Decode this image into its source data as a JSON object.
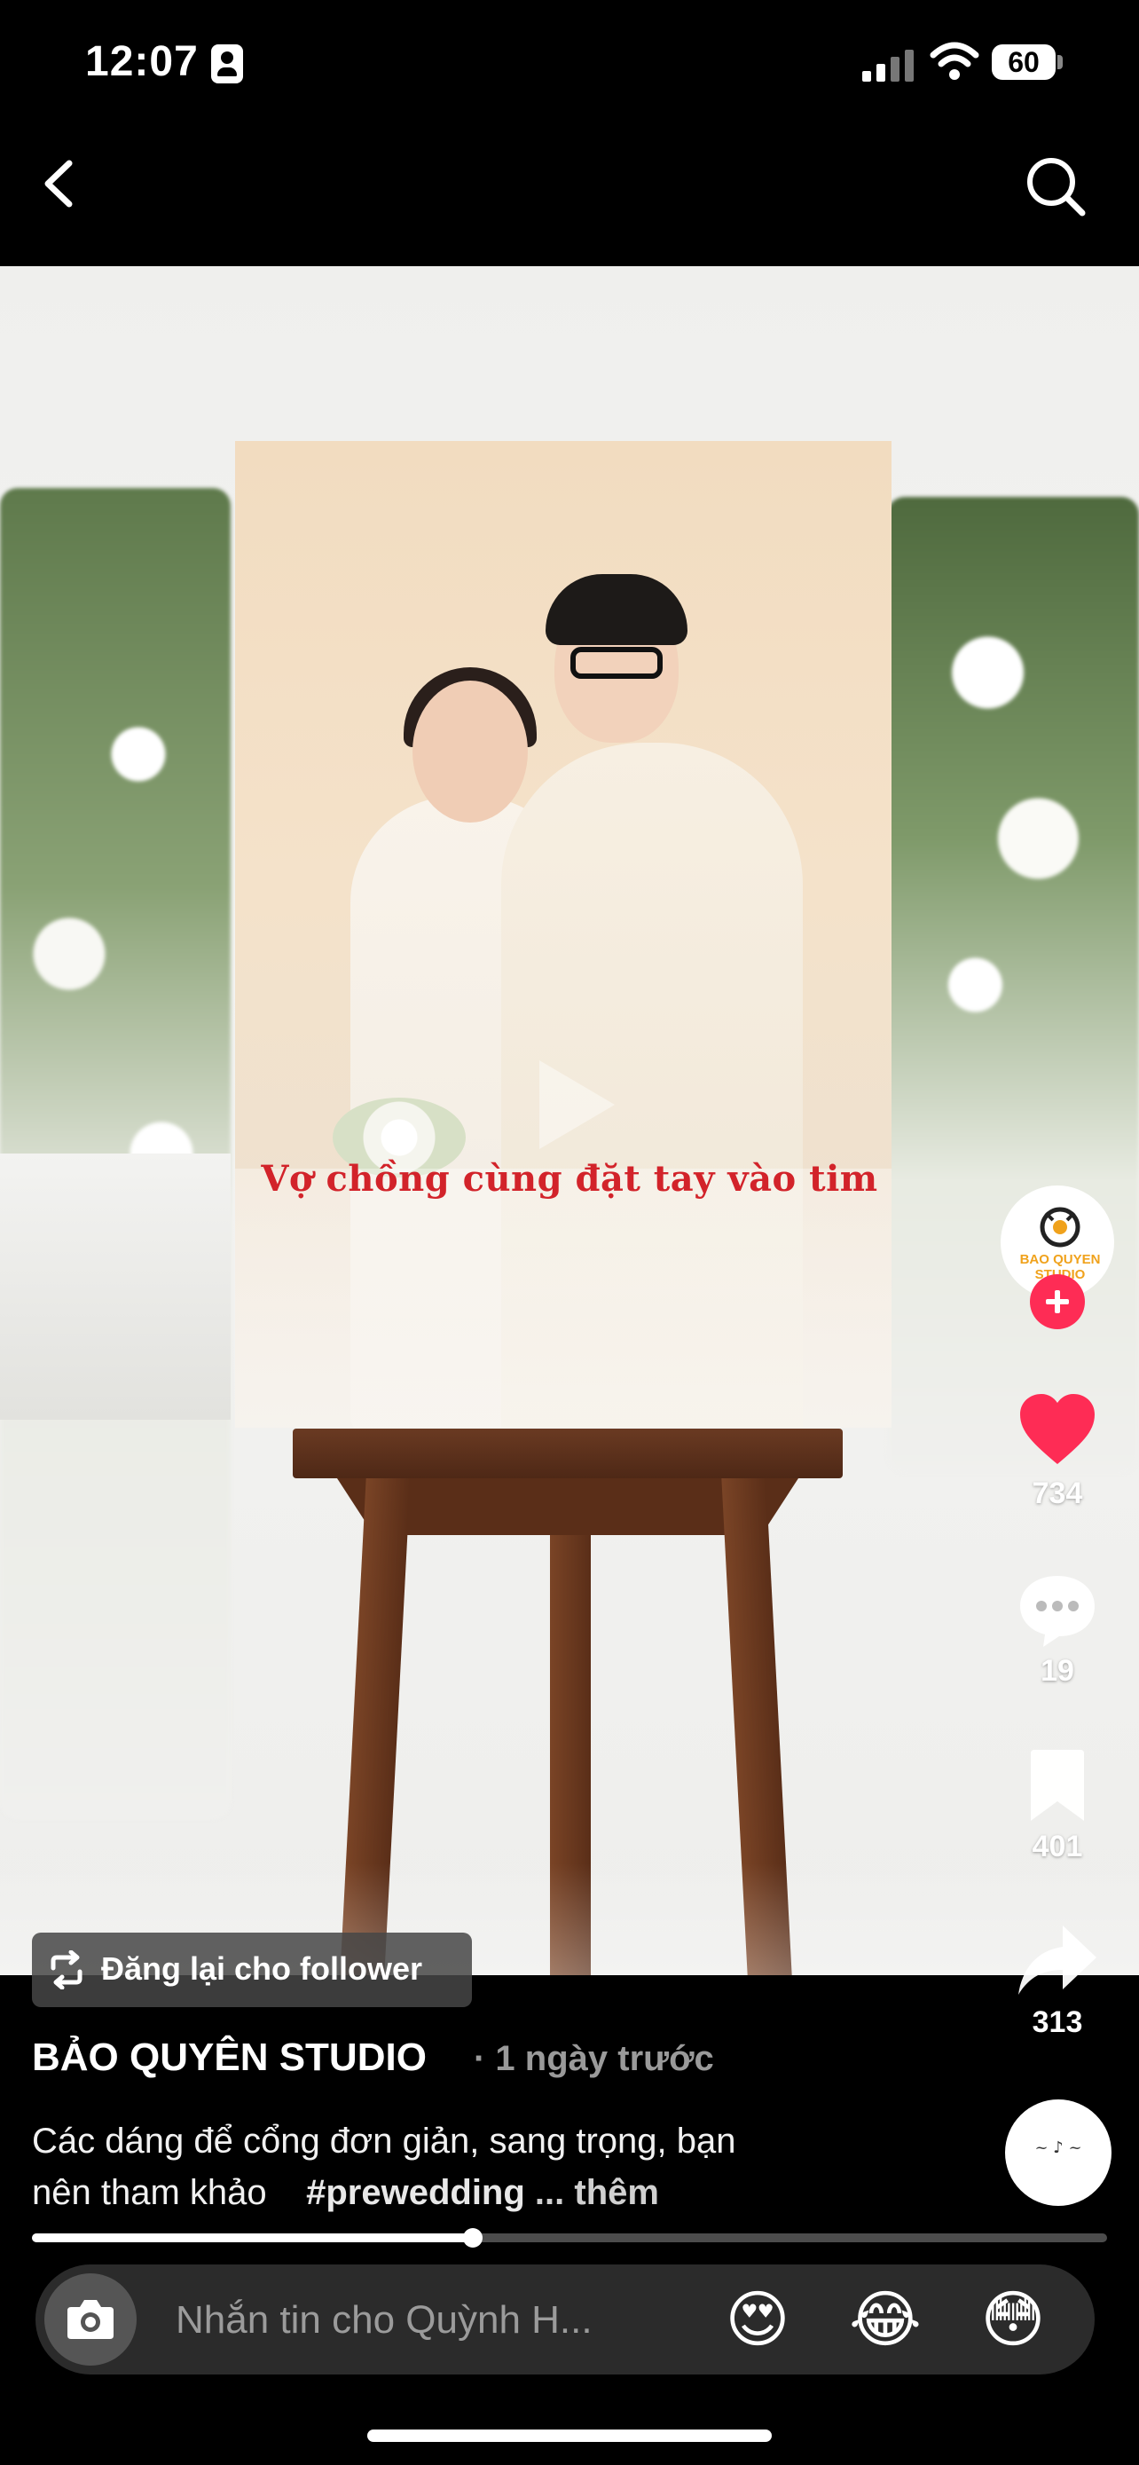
{
  "status_bar": {
    "time": "12:07",
    "battery": "60"
  },
  "video": {
    "caption": "Vợ  chồng cùng đặt tay  vào tim",
    "avatar_text": "BAO QUYEN STUDIO"
  },
  "actions": {
    "likes": "734",
    "comments": "19",
    "saves": "401",
    "shares": "313"
  },
  "repost": {
    "label": "Đăng lại cho follower"
  },
  "post": {
    "author": "BẢO QUYÊN STUDIO",
    "time": "· 1 ngày trước",
    "description_line1": "Các dáng để cổng đơn giản, sang trọng, bạn",
    "description_line2": "nên tham khảo",
    "hashtag": "#prewedding",
    "more": "... thêm"
  },
  "progress": {
    "fraction": 0.41
  },
  "message_bar": {
    "placeholder": "Nhắn tin cho Quỳnh H...",
    "emojis": [
      "😍",
      "😂",
      "😳"
    ]
  },
  "colors": {
    "like": "#fe2c55",
    "follow": "#fe2c55",
    "caption": "#d2232a",
    "background": "#000000"
  },
  "icons": [
    "back-icon",
    "search-icon",
    "heart-icon",
    "comment-icon",
    "bookmark-icon",
    "share-icon",
    "repost-icon",
    "camera-icon",
    "plus-icon"
  ]
}
